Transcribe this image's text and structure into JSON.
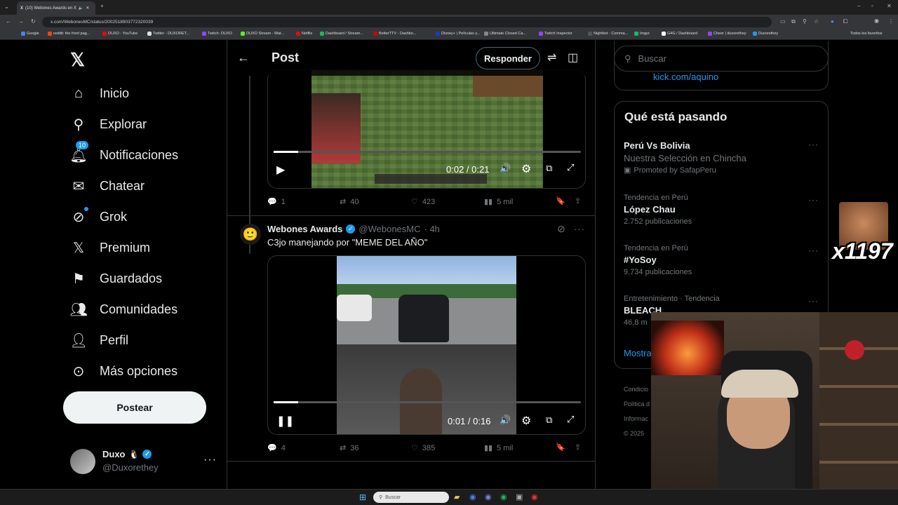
{
  "browser": {
    "tab_title": "(10) Webones Awards en X",
    "url": "x.com/WebonesMC/status/2002518903772320039",
    "bookmarks": [
      "Google",
      "reddit: the front pag...",
      "DUXO - YouTube",
      "Twitter - DUXORET...",
      "Twitch- DUXO",
      "DUXO Stream - Wat...",
      "Netflix",
      "Dashboard / Stream...",
      "BetterTTV - Dashbo...",
      "Disney+ | Películas y...",
      "Ultimate Closed Ca...",
      "Twitch Inspector",
      "Nightbot - Comma...",
      "Imgur",
      "G4G / Dashboard",
      "Cheer | duxorethey",
      "Duxorethey"
    ],
    "all_bookmarks": "Todos los favoritos"
  },
  "nav": {
    "items": [
      {
        "label": "Inicio",
        "icon": "home-icon"
      },
      {
        "label": "Explorar",
        "icon": "search-icon"
      },
      {
        "label": "Notificaciones",
        "icon": "bell-icon",
        "badge": "10"
      },
      {
        "label": "Chatear",
        "icon": "mail-icon"
      },
      {
        "label": "Grok",
        "icon": "grok-icon"
      },
      {
        "label": "Premium",
        "icon": "x-logo-icon"
      },
      {
        "label": "Guardados",
        "icon": "bookmark-icon"
      },
      {
        "label": "Comunidades",
        "icon": "people-icon"
      },
      {
        "label": "Perfil",
        "icon": "person-icon"
      },
      {
        "label": "Más opciones",
        "icon": "more-circle-icon"
      }
    ],
    "post_button": "Postear"
  },
  "account": {
    "name": "Duxo",
    "handle": "@Duxorethey"
  },
  "header": {
    "title": "Post",
    "reply_button": "Responder"
  },
  "tweets": [
    {
      "video_time": "0:02 / 0:21",
      "stats": {
        "replies": "1",
        "reposts": "40",
        "likes": "423",
        "views": "5 mil"
      }
    },
    {
      "author": "Webones Awards",
      "handle": "@WebonesMC",
      "time": "· 4h",
      "text": "C3jo manejando por \"MEME DEL AÑO\"",
      "video_time": "0:01 / 0:16",
      "stats": {
        "replies": "4",
        "reposts": "36",
        "likes": "385",
        "views": "5 mil"
      }
    }
  ],
  "right": {
    "search_placeholder": "Buscar",
    "kick_link": "kick.com/aquino",
    "trends_title": "Qué está pasando",
    "trends": [
      {
        "meta": "",
        "title": "Perú Vs Bolivia",
        "sub": "Nuestra Selección en Chincha",
        "promo": "Promoted by SafapPeru"
      },
      {
        "meta": "Tendencia en Perú",
        "title": "López Chau",
        "sub": "2.752 publicaciones"
      },
      {
        "meta": "Tendencia en Perú",
        "title": "#YoSoy",
        "sub": "9.734 publicaciones"
      },
      {
        "meta": "Entretenimiento · Tendencia",
        "title": "BLEACH",
        "sub": "46,8 m"
      }
    ],
    "show_more": "Mostra",
    "footer": [
      "Condicio",
      "Política d",
      "Informac",
      "© 2025"
    ]
  },
  "overlay": {
    "counter": "x1197"
  },
  "taskbar": {
    "search_placeholder": "Buscar"
  }
}
